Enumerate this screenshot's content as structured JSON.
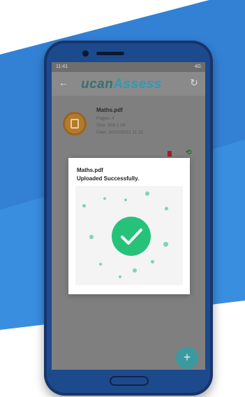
{
  "status_bar": {
    "time": "11:41",
    "right": "4G"
  },
  "app_bar": {
    "brand_part1": "ucan",
    "brand_part2": "Assess"
  },
  "file": {
    "name": "Maths.pdf",
    "pages": "Pages: 4",
    "size": "Size: 508.1 kB",
    "date": "Date: 10/12/2021 11:31"
  },
  "dialog": {
    "file_name": "Maths.pdf",
    "message": "Uploaded Successfully."
  },
  "fab": {
    "label": "+"
  },
  "colors": {
    "background_band": "#2f7fd6",
    "success": "#27c27a",
    "fab": "#3a9a9f"
  }
}
